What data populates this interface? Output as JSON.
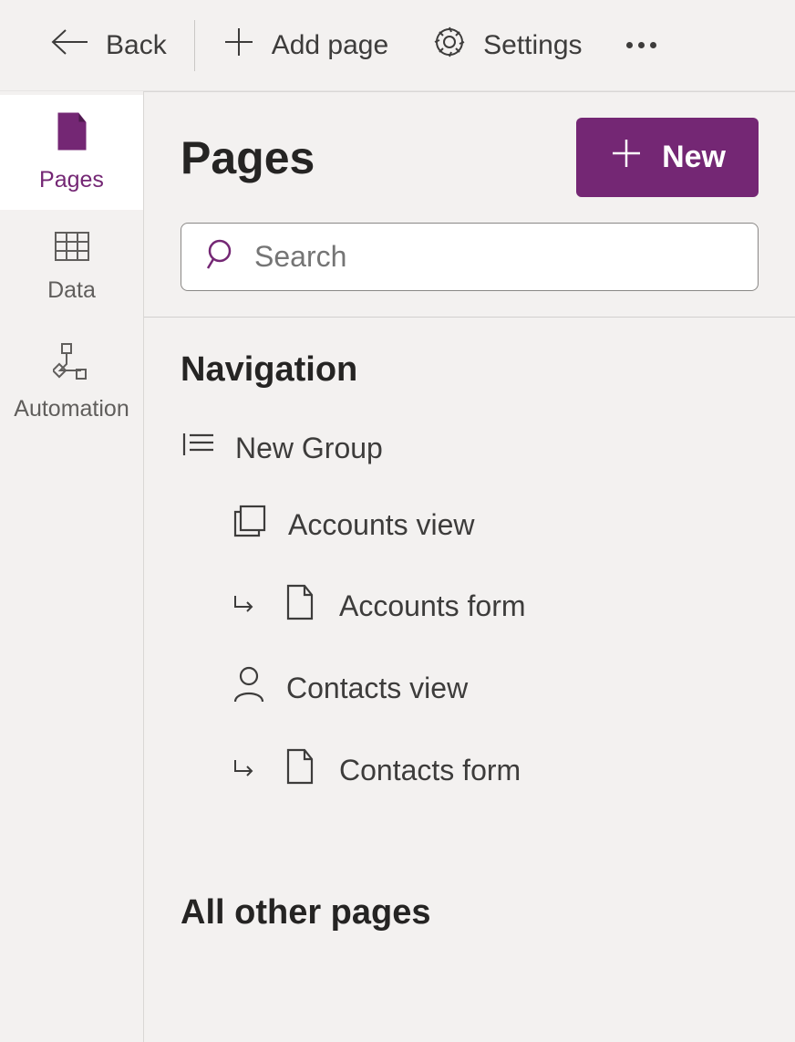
{
  "topbar": {
    "back_label": "Back",
    "add_page_label": "Add page",
    "settings_label": "Settings"
  },
  "leftrail": {
    "items": [
      {
        "label": "Pages",
        "icon": "page-icon",
        "active": true
      },
      {
        "label": "Data",
        "icon": "table-icon",
        "active": false
      },
      {
        "label": "Automation",
        "icon": "flow-icon",
        "active": false
      }
    ]
  },
  "main": {
    "title": "Pages",
    "new_button_label": "New",
    "search_placeholder": "Search",
    "navigation_title": "Navigation",
    "group_label": "New Group",
    "nav_items": [
      {
        "label": "Accounts view",
        "icon": "view-icon",
        "type": "view"
      },
      {
        "label": "Accounts form",
        "icon": "form-icon",
        "type": "form"
      },
      {
        "label": "Contacts view",
        "icon": "person-icon",
        "type": "view"
      },
      {
        "label": "Contacts form",
        "icon": "form-icon",
        "type": "form"
      }
    ],
    "all_other_title": "All other pages"
  }
}
